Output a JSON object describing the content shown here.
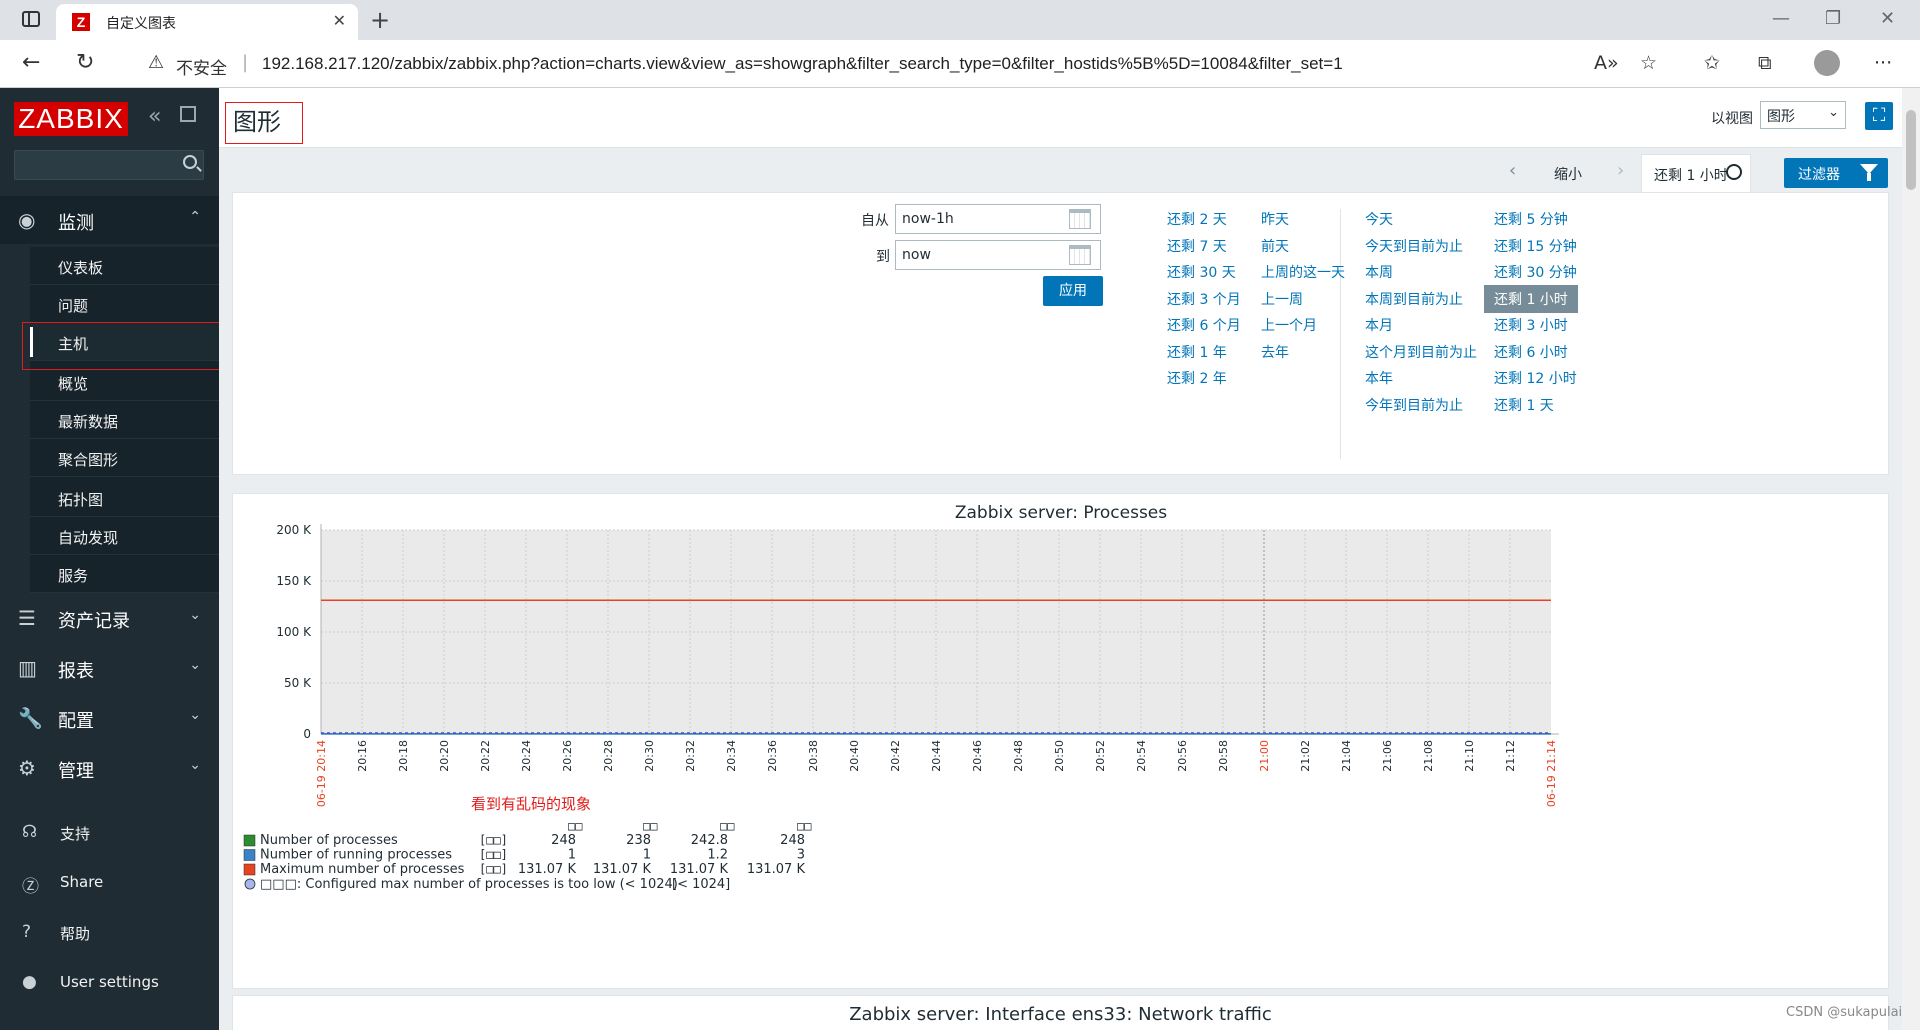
{
  "browser": {
    "tab_title": "自定义图表",
    "tab_favicon": "Z",
    "insecure_label": "不安全",
    "url": "192.168.217.120/zabbix/zabbix.php?action=charts.view&view_as=showgraph&filter_search_type=0&filter_hostids%5B%5D=10084&filter_set=1"
  },
  "sidebar": {
    "logo": "ZABBIX",
    "search_placeholder": "",
    "sections": [
      {
        "label": "监测",
        "icon": "eye-icon"
      },
      {
        "label": "资产记录",
        "icon": "list-icon"
      },
      {
        "label": "报表",
        "icon": "chart-icon"
      },
      {
        "label": "配置",
        "icon": "wrench-icon"
      },
      {
        "label": "管理",
        "icon": "gear-icon"
      }
    ],
    "monitoring_items": [
      "仪表板",
      "问题",
      "主机",
      "概览",
      "最新数据",
      "聚合图形",
      "拓扑图",
      "自动发现",
      "服务"
    ],
    "bottom_items": [
      {
        "label": "支持",
        "icon": "headset-icon"
      },
      {
        "label": "Share",
        "icon": "share-icon"
      },
      {
        "label": "帮助",
        "icon": "help-icon"
      },
      {
        "label": "User settings",
        "icon": "user-icon"
      }
    ]
  },
  "header": {
    "title": "图形",
    "view_as_label": "以视图",
    "view_as_value": "图形"
  },
  "timebar": {
    "zoom_out": "缩小",
    "active_tab": "还剩 1 小时",
    "filter_button": "过滤器"
  },
  "filter": {
    "from_label": "自从",
    "from_value": "now-1h",
    "to_label": "到",
    "to_value": "now",
    "apply": "应用",
    "quick": {
      "col1": [
        "还剩 2 天",
        "还剩 7 天",
        "还剩 30 天",
        "还剩 3 个月",
        "还剩 6 个月",
        "还剩 1 年",
        "还剩 2 年"
      ],
      "col2": [
        "昨天",
        "前天",
        "上周的这一天",
        "上一周",
        "上一个月",
        "去年"
      ],
      "col3": [
        "今天",
        "今天到目前为止",
        "本周",
        "本周到目前为止",
        "本月",
        "这个月到目前为止",
        "本年",
        "今年到目前为止"
      ],
      "col4": [
        "还剩 5 分钟",
        "还剩 15 分钟",
        "还剩 30 分钟",
        "还剩 1 小时",
        "还剩 3 小时",
        "还剩 6 小时",
        "还剩 12 小时",
        "还剩 1 天"
      ]
    }
  },
  "graph": {
    "annotation": "看到有乱码的现象",
    "legend_col_headers": [
      "□□",
      "□□",
      "□□",
      "□□"
    ],
    "legend": [
      {
        "name": "Number of processes",
        "func": "[□□]",
        "last": "248",
        "min": "238",
        "avg": "242.8",
        "max": "248",
        "color": "#2e8b2e"
      },
      {
        "name": "Number of running processes",
        "func": "[□□]",
        "last": "1",
        "min": "1",
        "avg": "1.2",
        "max": "3",
        "color": "#3b82c4"
      },
      {
        "name": "Maximum number of processes",
        "func": "[□□]",
        "last": "131.07 K",
        "min": "131.07 K",
        "avg": "131.07 K",
        "max": "131.07 K",
        "color": "#e8431f"
      }
    ],
    "trigger": {
      "label": "□□□: Configured max number of processes is too low (< 1024)",
      "value": "[< 1024]"
    }
  },
  "chart_data": {
    "type": "line",
    "title": "Zabbix server: Processes",
    "y_ticks": [
      "0",
      "50 K",
      "100 K",
      "150 K",
      "200 K"
    ],
    "ylim": [
      0,
      200000
    ],
    "x_start_label": "06-19 20:14",
    "x_end_label": "06-19 21:14",
    "x_ticks": [
      "20:16",
      "20:18",
      "20:20",
      "20:22",
      "20:24",
      "20:26",
      "20:28",
      "20:30",
      "20:32",
      "20:34",
      "20:36",
      "20:38",
      "20:40",
      "20:42",
      "20:44",
      "20:46",
      "20:48",
      "20:50",
      "20:52",
      "20:54",
      "20:56",
      "20:58",
      "21:00",
      "21:02",
      "21:04",
      "21:06",
      "21:08",
      "21:10",
      "21:12"
    ],
    "highlight_tick": "21:00",
    "series": [
      {
        "name": "Number of processes",
        "values": [
          248,
          248
        ],
        "color": "#2e8b2e"
      },
      {
        "name": "Number of running processes",
        "values": [
          1,
          1
        ],
        "color": "#3b82c4"
      },
      {
        "name": "Maximum number of processes",
        "values": [
          131070,
          131070
        ],
        "color": "#e8431f"
      }
    ],
    "grid": true
  },
  "graph2": {
    "title": "Zabbix server: Interface ens33: Network traffic"
  },
  "watermark": "CSDN @sukapulai"
}
